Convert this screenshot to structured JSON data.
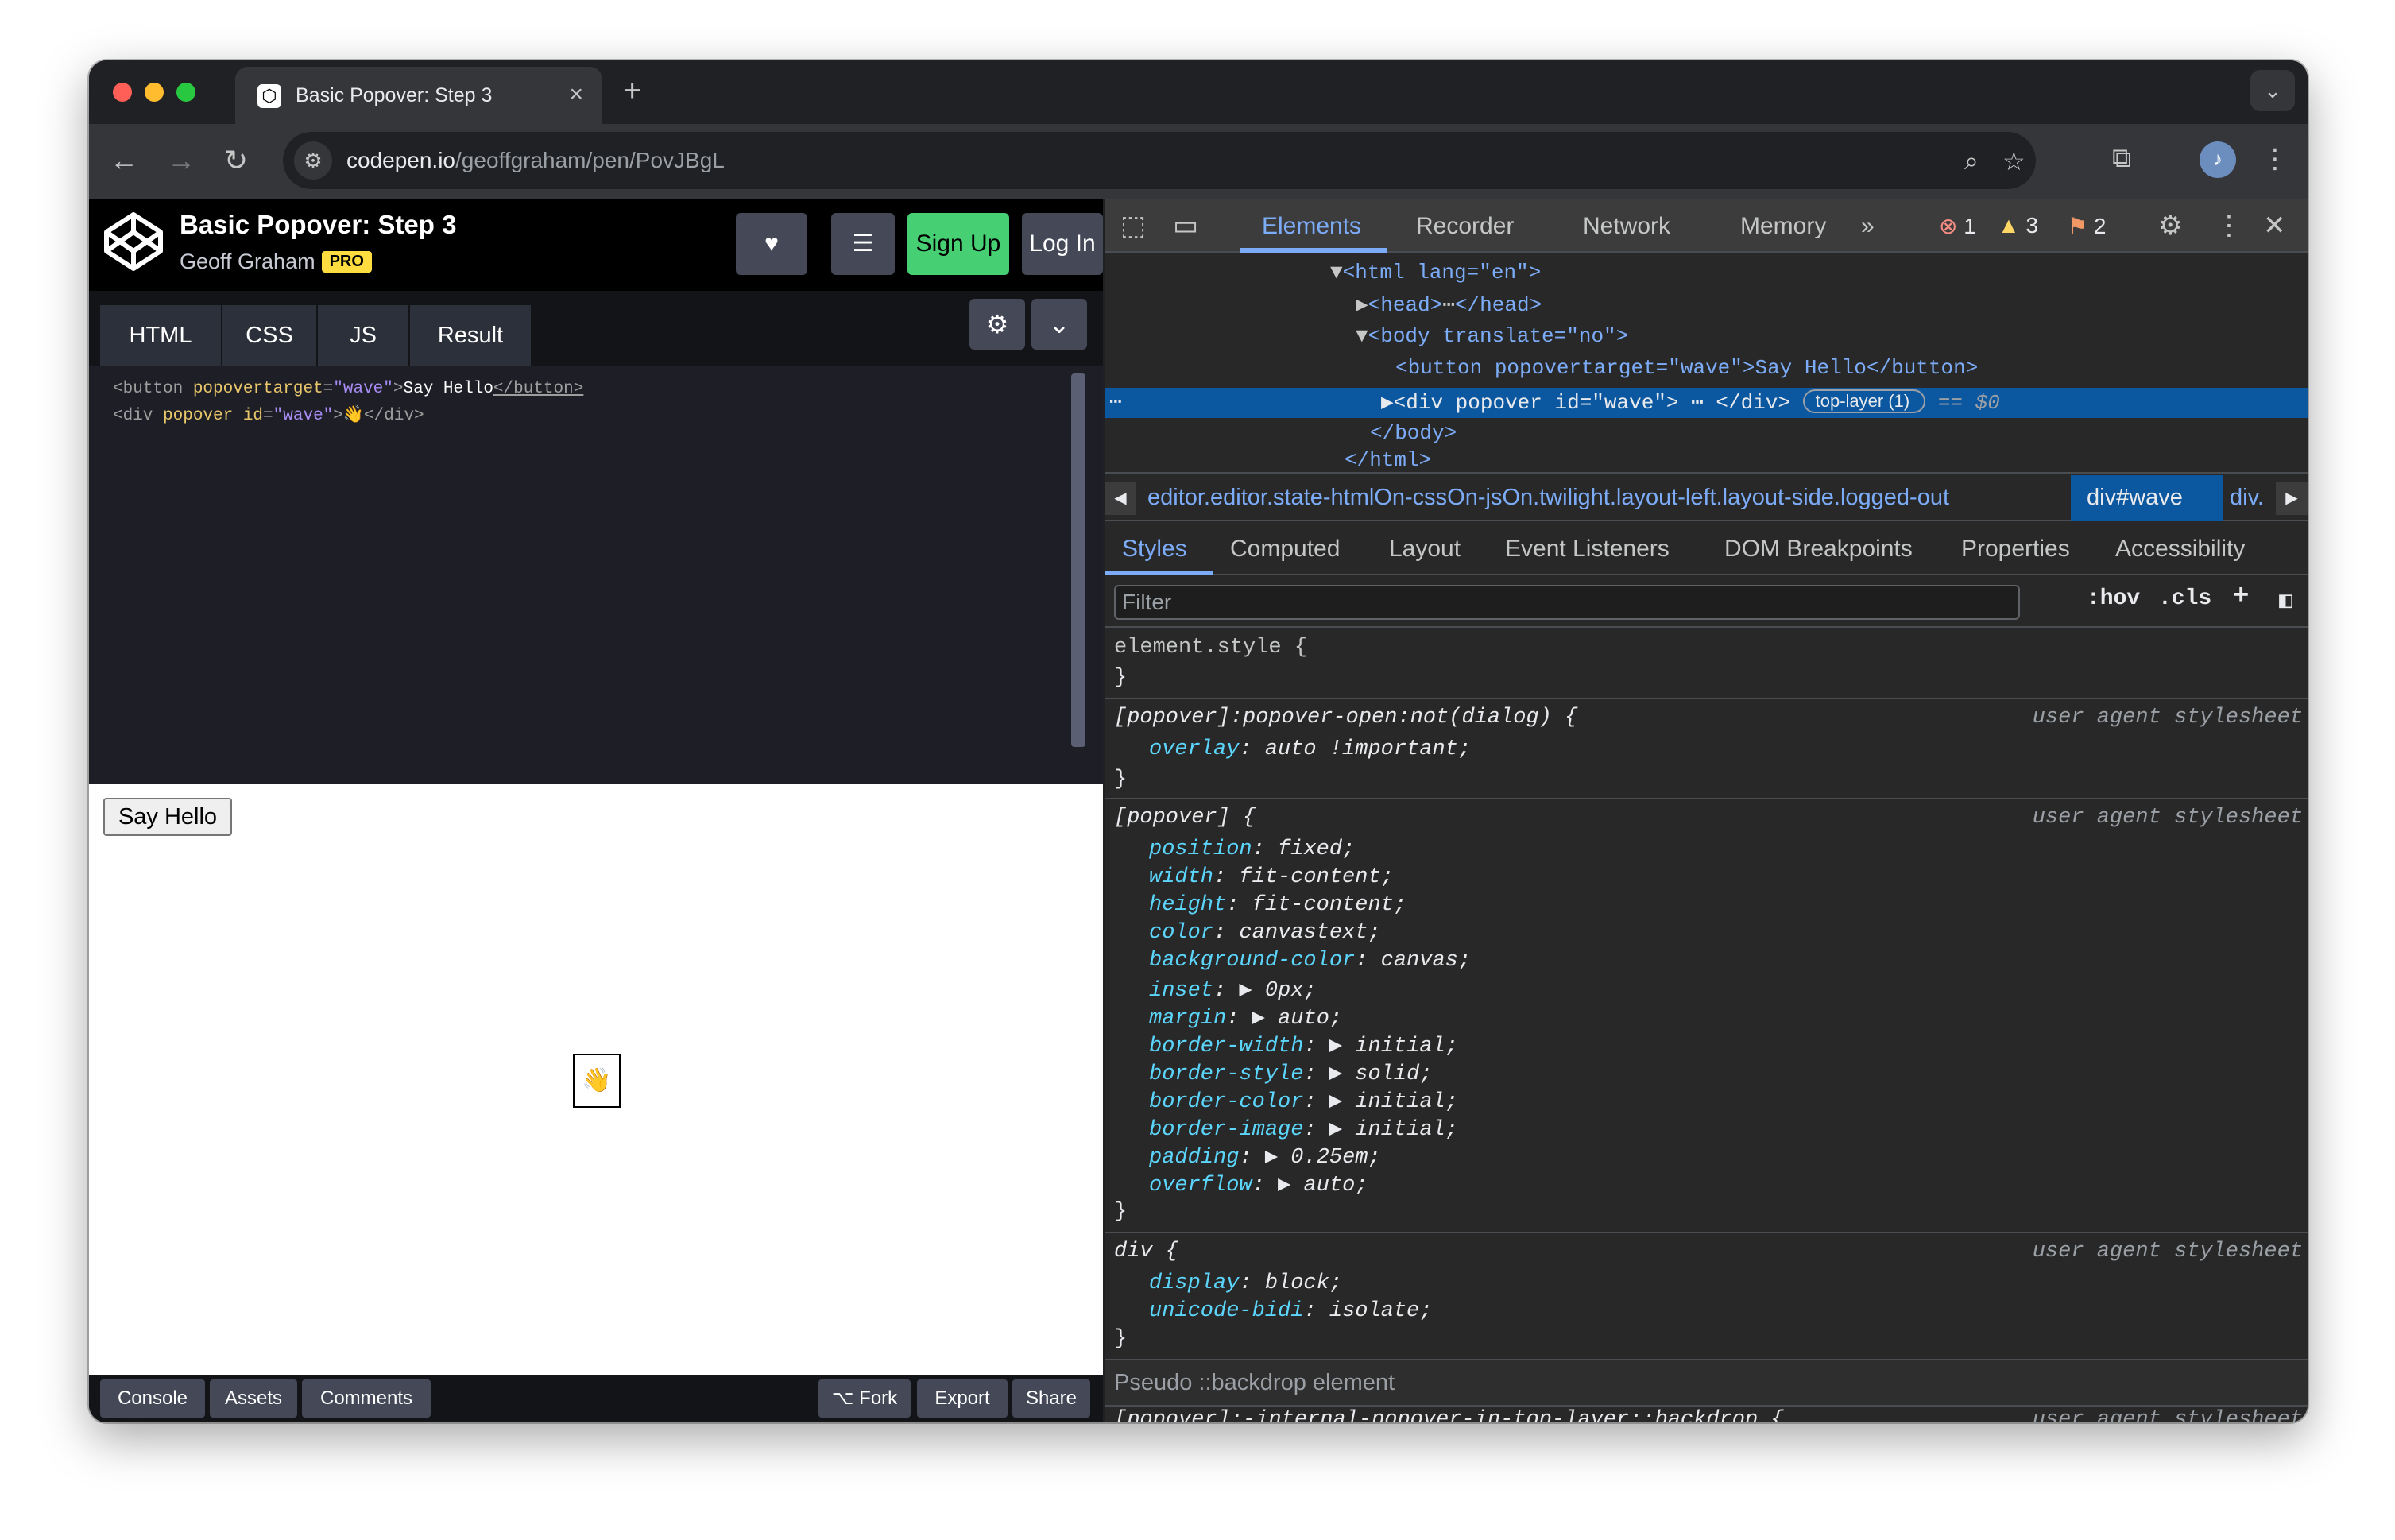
{
  "browser": {
    "tab_title": "Basic Popover: Step 3",
    "tab_close": "×",
    "new_tab": "+",
    "url_host": "codepen.io",
    "url_path": "/geoffgraham/pen/PovJBgL"
  },
  "codepen": {
    "title": "Basic Popover: Step 3",
    "author": "Geoff Graham",
    "pro_badge": "PRO",
    "signup_label": "Sign Up",
    "login_label": "Log In",
    "tabs": [
      "HTML",
      "CSS",
      "JS",
      "Result"
    ],
    "code_lines": [
      {
        "open": "<button ",
        "attr": "popovertarget",
        "eq": "=",
        "val": "\"wave\"",
        "close": ">",
        "text": "Say Hello",
        "end": "</button>"
      },
      {
        "open": "<div ",
        "attr": "popover id",
        "eq": "=",
        "val": "\"wave\"",
        "close": ">",
        "text": "👋",
        "end": "</div>"
      }
    ],
    "result_button": "Say Hello",
    "popover_content": "👋",
    "footer": {
      "console": "Console",
      "assets": "Assets",
      "comments": "Comments",
      "fork": "Fork",
      "export": "Export",
      "share": "Share"
    }
  },
  "devtools": {
    "tabs": [
      "Elements",
      "Recorder",
      "Network",
      "Memory"
    ],
    "more_tabs": "»",
    "errors": "1",
    "warnings": "3",
    "issues": "2",
    "dom": {
      "html_open": "<html lang=\"en\">",
      "head": "<head>",
      "head_close": "</head>",
      "body_open": "<body translate=\"no\">",
      "button_line": "<button popovertarget=\"wave\">Say Hello</button>",
      "div_line": "<div popover id=\"wave\">",
      "div_close": "</div>",
      "top_layer": "top-layer (1)",
      "dollar": "== $0",
      "body_close": "</body>",
      "html_close": "</html>"
    },
    "breadcrumbs": {
      "first": "editor.editor.state-htmlOn-cssOn-jsOn.twilight.layout-left.layout-side.logged-out",
      "selected": "div#wave",
      "last": "div."
    },
    "subtabs": [
      "Styles",
      "Computed",
      "Layout",
      "Event Listeners",
      "DOM Breakpoints",
      "Properties",
      "Accessibility"
    ],
    "filter_placeholder": "Filter",
    "hov": ":hov",
    "cls": ".cls",
    "rules": {
      "element_style": "element.style {",
      "popover_open_selector": "[popover]:popover-open:not(dialog) {",
      "popover_open_props": [
        {
          "name": "overlay",
          "value": ": auto !important;"
        }
      ],
      "popover_selector": "[popover] {",
      "popover_props": [
        {
          "name": "position",
          "value": ": fixed;"
        },
        {
          "name": "width",
          "value": ": fit-content;"
        },
        {
          "name": "height",
          "value": ": fit-content;"
        },
        {
          "name": "color",
          "value": ": canvastext;"
        },
        {
          "name": "background-color",
          "value": ": canvas;"
        },
        {
          "name": "inset",
          "value": ": ▶ 0px;"
        },
        {
          "name": "margin",
          "value": ": ▶ auto;"
        },
        {
          "name": "border-width",
          "value": ": ▶ initial;"
        },
        {
          "name": "border-style",
          "value": ": ▶ solid;"
        },
        {
          "name": "border-color",
          "value": ": ▶ initial;"
        },
        {
          "name": "border-image",
          "value": ": ▶ initial;"
        },
        {
          "name": "padding",
          "value": ": ▶ 0.25em;"
        },
        {
          "name": "overflow",
          "value": ": ▶ auto;"
        }
      ],
      "div_selector": "div {",
      "div_props": [
        {
          "name": "display",
          "value": ": block;"
        },
        {
          "name": "unicode-bidi",
          "value": ": isolate;"
        }
      ],
      "close_brace": "}",
      "origin": "user agent stylesheet",
      "pseudo_label": "Pseudo ::backdrop element",
      "backdrop_selector": "[popover]:-internal-popover-in-top-layer::backdrop {"
    }
  }
}
